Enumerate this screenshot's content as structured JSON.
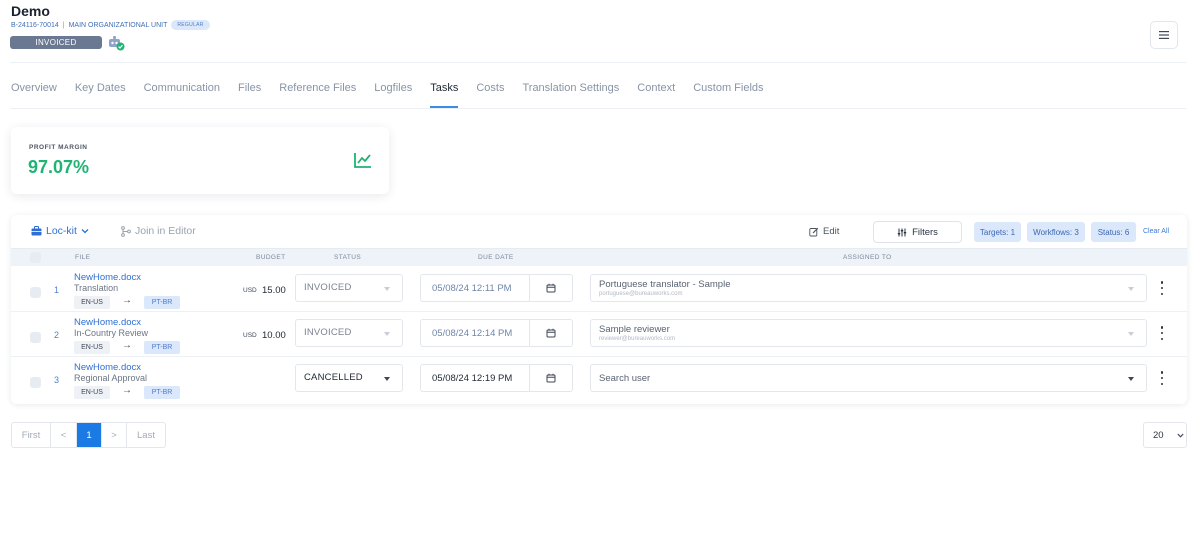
{
  "header": {
    "title": "Demo",
    "project_code": "B-24116-70014",
    "separator": "|",
    "org_unit": "MAIN ORGANIZATIONAL UNIT",
    "type_badge": "REGULAR",
    "status_label": "INVOICED"
  },
  "tabs": [
    {
      "label": "Overview"
    },
    {
      "label": "Key Dates"
    },
    {
      "label": "Communication"
    },
    {
      "label": "Files"
    },
    {
      "label": "Reference Files"
    },
    {
      "label": "Logfiles"
    },
    {
      "label": "Tasks",
      "active": true
    },
    {
      "label": "Costs"
    },
    {
      "label": "Translation Settings"
    },
    {
      "label": "Context"
    },
    {
      "label": "Custom Fields"
    }
  ],
  "profit": {
    "label": "PROFIT MARGIN",
    "value": "97.07%",
    "icon": "trend-chart-icon",
    "color": "#1eb473"
  },
  "toolbar": {
    "lockit_label": "Loc-kit",
    "join_label": "Join in Editor",
    "edit_label": "Edit",
    "filters_label": "Filters",
    "chips": [
      "Targets: 1",
      "Workflows: 3",
      "Status: 6"
    ],
    "clear_all": "Clear All"
  },
  "columns": {
    "file": "FILE",
    "budget": "BUDGET",
    "status": "STATUS",
    "due_date": "DUE DATE",
    "assigned_to": "ASSIGNED TO"
  },
  "rows": [
    {
      "num": "1",
      "file": "NewHome.docx",
      "task": "Translation",
      "source_lang": "EN-US",
      "arrow": "→",
      "target_lang": "PT-BR",
      "currency": "USD",
      "amount": "15.00",
      "status": "INVOICED",
      "due": "05/08/24 12:11 PM",
      "assignee": "Portuguese translator - Sample",
      "email": "portuguese@bureauworks.com"
    },
    {
      "num": "2",
      "file": "NewHome.docx",
      "task": "In-Country Review",
      "source_lang": "EN-US",
      "arrow": "→",
      "target_lang": "PT-BR",
      "currency": "USD",
      "amount": "10.00",
      "status": "INVOICED",
      "due": "05/08/24 12:14 PM",
      "assignee": "Sample reviewer",
      "email": "reviewer@bureauworks.com"
    },
    {
      "num": "3",
      "file": "NewHome.docx",
      "task": "Regional Approval",
      "source_lang": "EN-US",
      "arrow": "→",
      "target_lang": "PT-BR",
      "currency": "",
      "amount": "",
      "status": "CANCELLED",
      "due": "05/08/24 12:19 PM",
      "assignee_placeholder": "Search user"
    }
  ],
  "pagination": {
    "first": "First",
    "prev": "<",
    "current": "1",
    "next": ">",
    "last": "Last",
    "per_page": "20"
  },
  "colors": {
    "accent": "#1c7ae5",
    "link": "#2f6fd3",
    "status_pill": "#6b7891",
    "chip_bg": "#dbe7fb"
  }
}
